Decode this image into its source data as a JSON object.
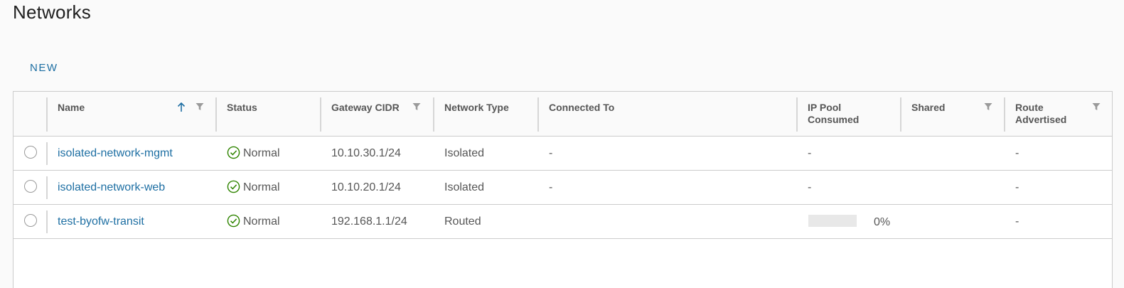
{
  "page": {
    "title": "Networks"
  },
  "toolbar": {
    "new_label": "NEW"
  },
  "grid": {
    "columns": {
      "name": "Name",
      "status": "Status",
      "gateway_cidr": "Gateway CIDR",
      "network_type": "Network Type",
      "connected_to": "Connected To",
      "ip_pool_line1": "IP Pool",
      "ip_pool_line2": "Consumed",
      "shared": "Shared",
      "route_line1": "Route",
      "route_line2": "Advertised"
    },
    "sort": {
      "column": "Name",
      "direction": "ascending"
    },
    "rows": [
      {
        "name": "isolated-network-mgmt",
        "status": "Normal",
        "gateway_cidr": "10.10.30.1/24",
        "network_type": "Isolated",
        "connected_to": "-",
        "ip_pool": "-",
        "shared": "",
        "route_advertised": "-"
      },
      {
        "name": "isolated-network-web",
        "status": "Normal",
        "gateway_cidr": "10.10.20.1/24",
        "network_type": "Isolated",
        "connected_to": "-",
        "ip_pool": "-",
        "shared": "",
        "route_advertised": "-"
      },
      {
        "name": "test-byofw-transit",
        "status": "Normal",
        "gateway_cidr": "192.168.1.1/24",
        "network_type": "Routed",
        "connected_to": "",
        "ip_pool_percent": 0,
        "ip_pool_label": "0%",
        "shared": "",
        "route_advertised": "-"
      }
    ]
  },
  "icons": {
    "status": "check-circle-icon",
    "filter": "filter-icon",
    "sort": "arrow-up-icon",
    "select": "radio-icon"
  },
  "colors": {
    "link": "#1e6fa3",
    "status_ok": "#2f8400",
    "border": "#cccccc",
    "progress_track": "#e8e8e8"
  }
}
